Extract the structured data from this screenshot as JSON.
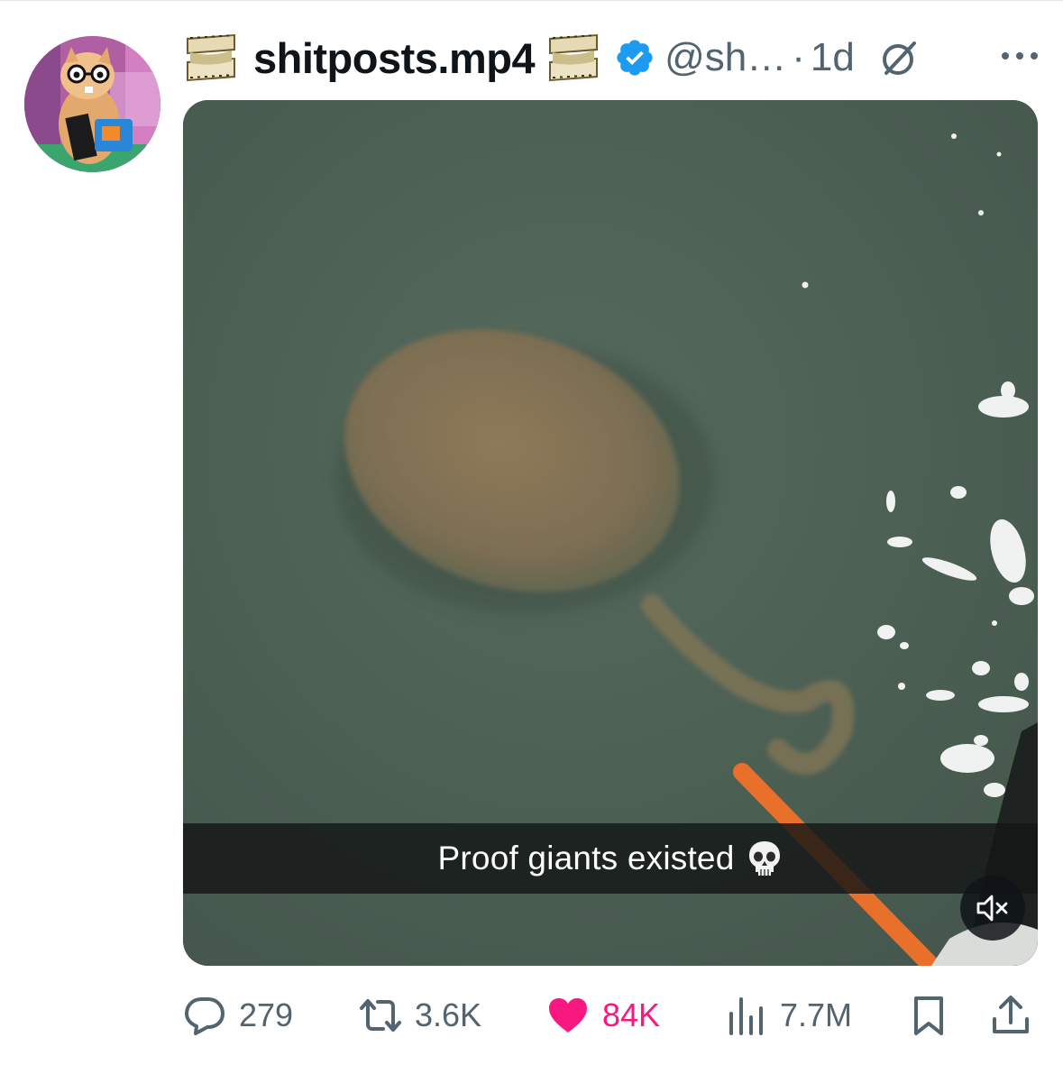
{
  "post": {
    "display_name": "shitposts.mp4",
    "handle": "@sh…",
    "separator": "·",
    "timestamp": "1d",
    "caption": "Proof giants existed"
  },
  "stats": {
    "replies": "279",
    "reposts": "3.6K",
    "likes": "84K",
    "views": "7.7M"
  },
  "icons": {
    "left_emoji": "film-frames-icon",
    "right_emoji": "film-frames-icon",
    "verified": "verified-badge-icon",
    "grok": "grok-icon",
    "more": "more-dots-icon",
    "caption_emoji": "skull-icon",
    "mute": "speaker-muted-icon",
    "reply": "reply-bubble-icon",
    "repost": "repost-arrows-icon",
    "like": "heart-icon",
    "views": "views-bars-icon",
    "bookmark": "bookmark-icon",
    "share": "share-icon"
  },
  "colors": {
    "verified": "#1d9bf0",
    "like": "#f91880",
    "secondary_text": "#536471",
    "water": "#4d5f52"
  },
  "state": {
    "liked": true,
    "muted": true
  }
}
